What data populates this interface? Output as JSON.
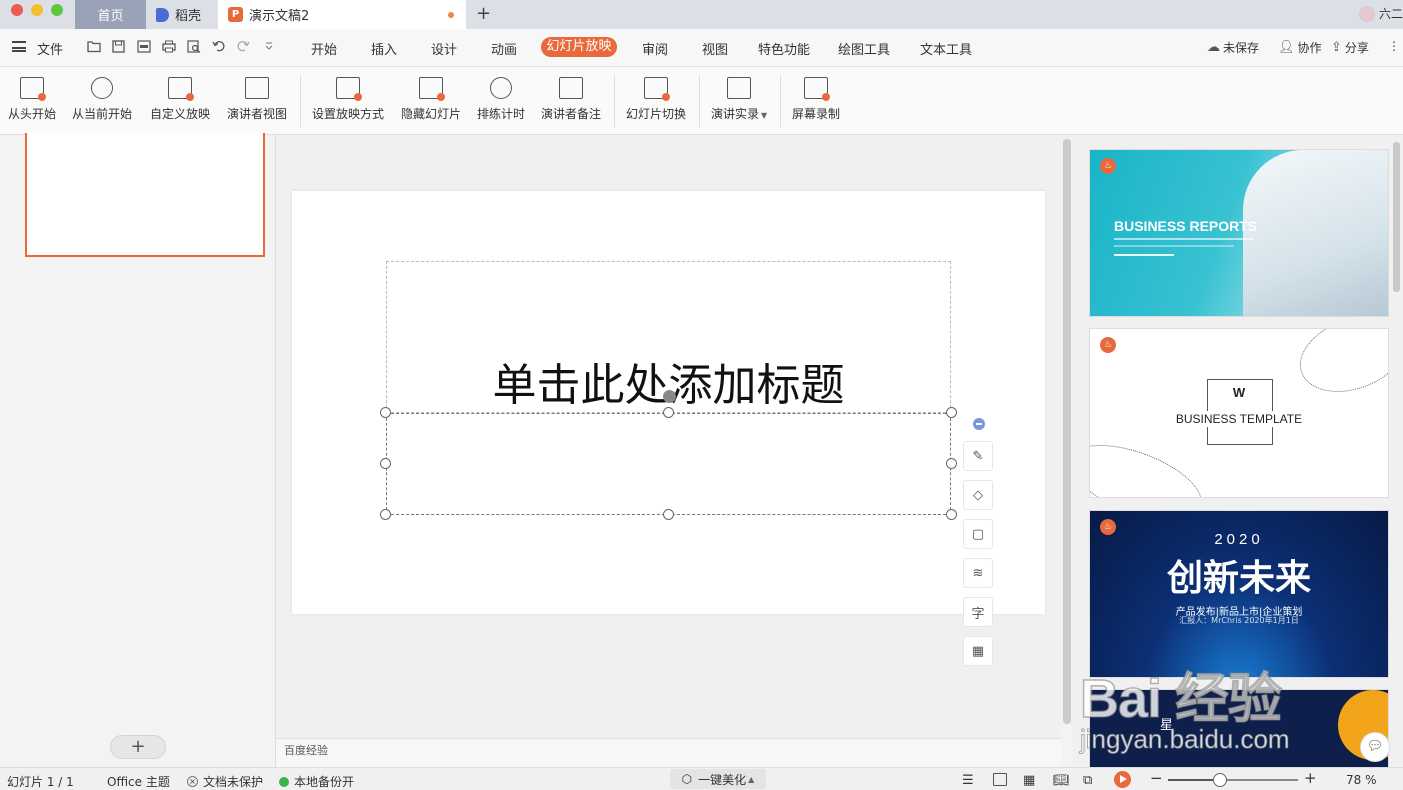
{
  "window": {
    "tabs": [
      {
        "label": "首页"
      },
      {
        "label": "稻壳"
      },
      {
        "label": "演示文稿2"
      }
    ],
    "new_tab": "+",
    "user_name": "六二"
  },
  "menu": {
    "file": "文件",
    "items": [
      "开始",
      "插入",
      "设计",
      "动画",
      "幻灯片放映",
      "审阅",
      "视图",
      "特色功能",
      "绘图工具",
      "文本工具"
    ],
    "active": "幻灯片放映",
    "unsaved": "未保存",
    "collab": "协作",
    "share": "分享"
  },
  "ribbon": {
    "buttons": [
      "从头开始",
      "从当前开始",
      "自定义放映",
      "演讲者视图",
      "设置放映方式",
      "隐藏幻灯片",
      "排练计时",
      "演讲者备注",
      "幻灯片切换",
      "演讲实录",
      "屏幕录制"
    ]
  },
  "slide": {
    "title_placeholder": "单击此处添加标题"
  },
  "notes": {
    "text": "百度经验"
  },
  "templates": {
    "t1_title": "BUSINESS REPORTS",
    "t2_title": "BUSINESS TEMPLATE",
    "t3_year": "2020",
    "t3_title": "创新未来",
    "t3_sub1": "产品发布|新品上市|企业策划",
    "t3_sub2": "汇报人：MrChris      2020年1月1日",
    "t4_title": "星"
  },
  "watermark": {
    "logo": "Bai 经验",
    "url": "jingyan.baidu.com"
  },
  "status": {
    "slide_counter": "幻灯片 1 / 1",
    "theme": "Office 主题",
    "protect": "文档未保护",
    "backup": "本地备份开",
    "beautify": "一键美化",
    "zoom": "78 %",
    "zoom_fraction": 0.4
  },
  "colors": {
    "accent": "#e86a3c",
    "backup_green": "#3bb54a"
  }
}
